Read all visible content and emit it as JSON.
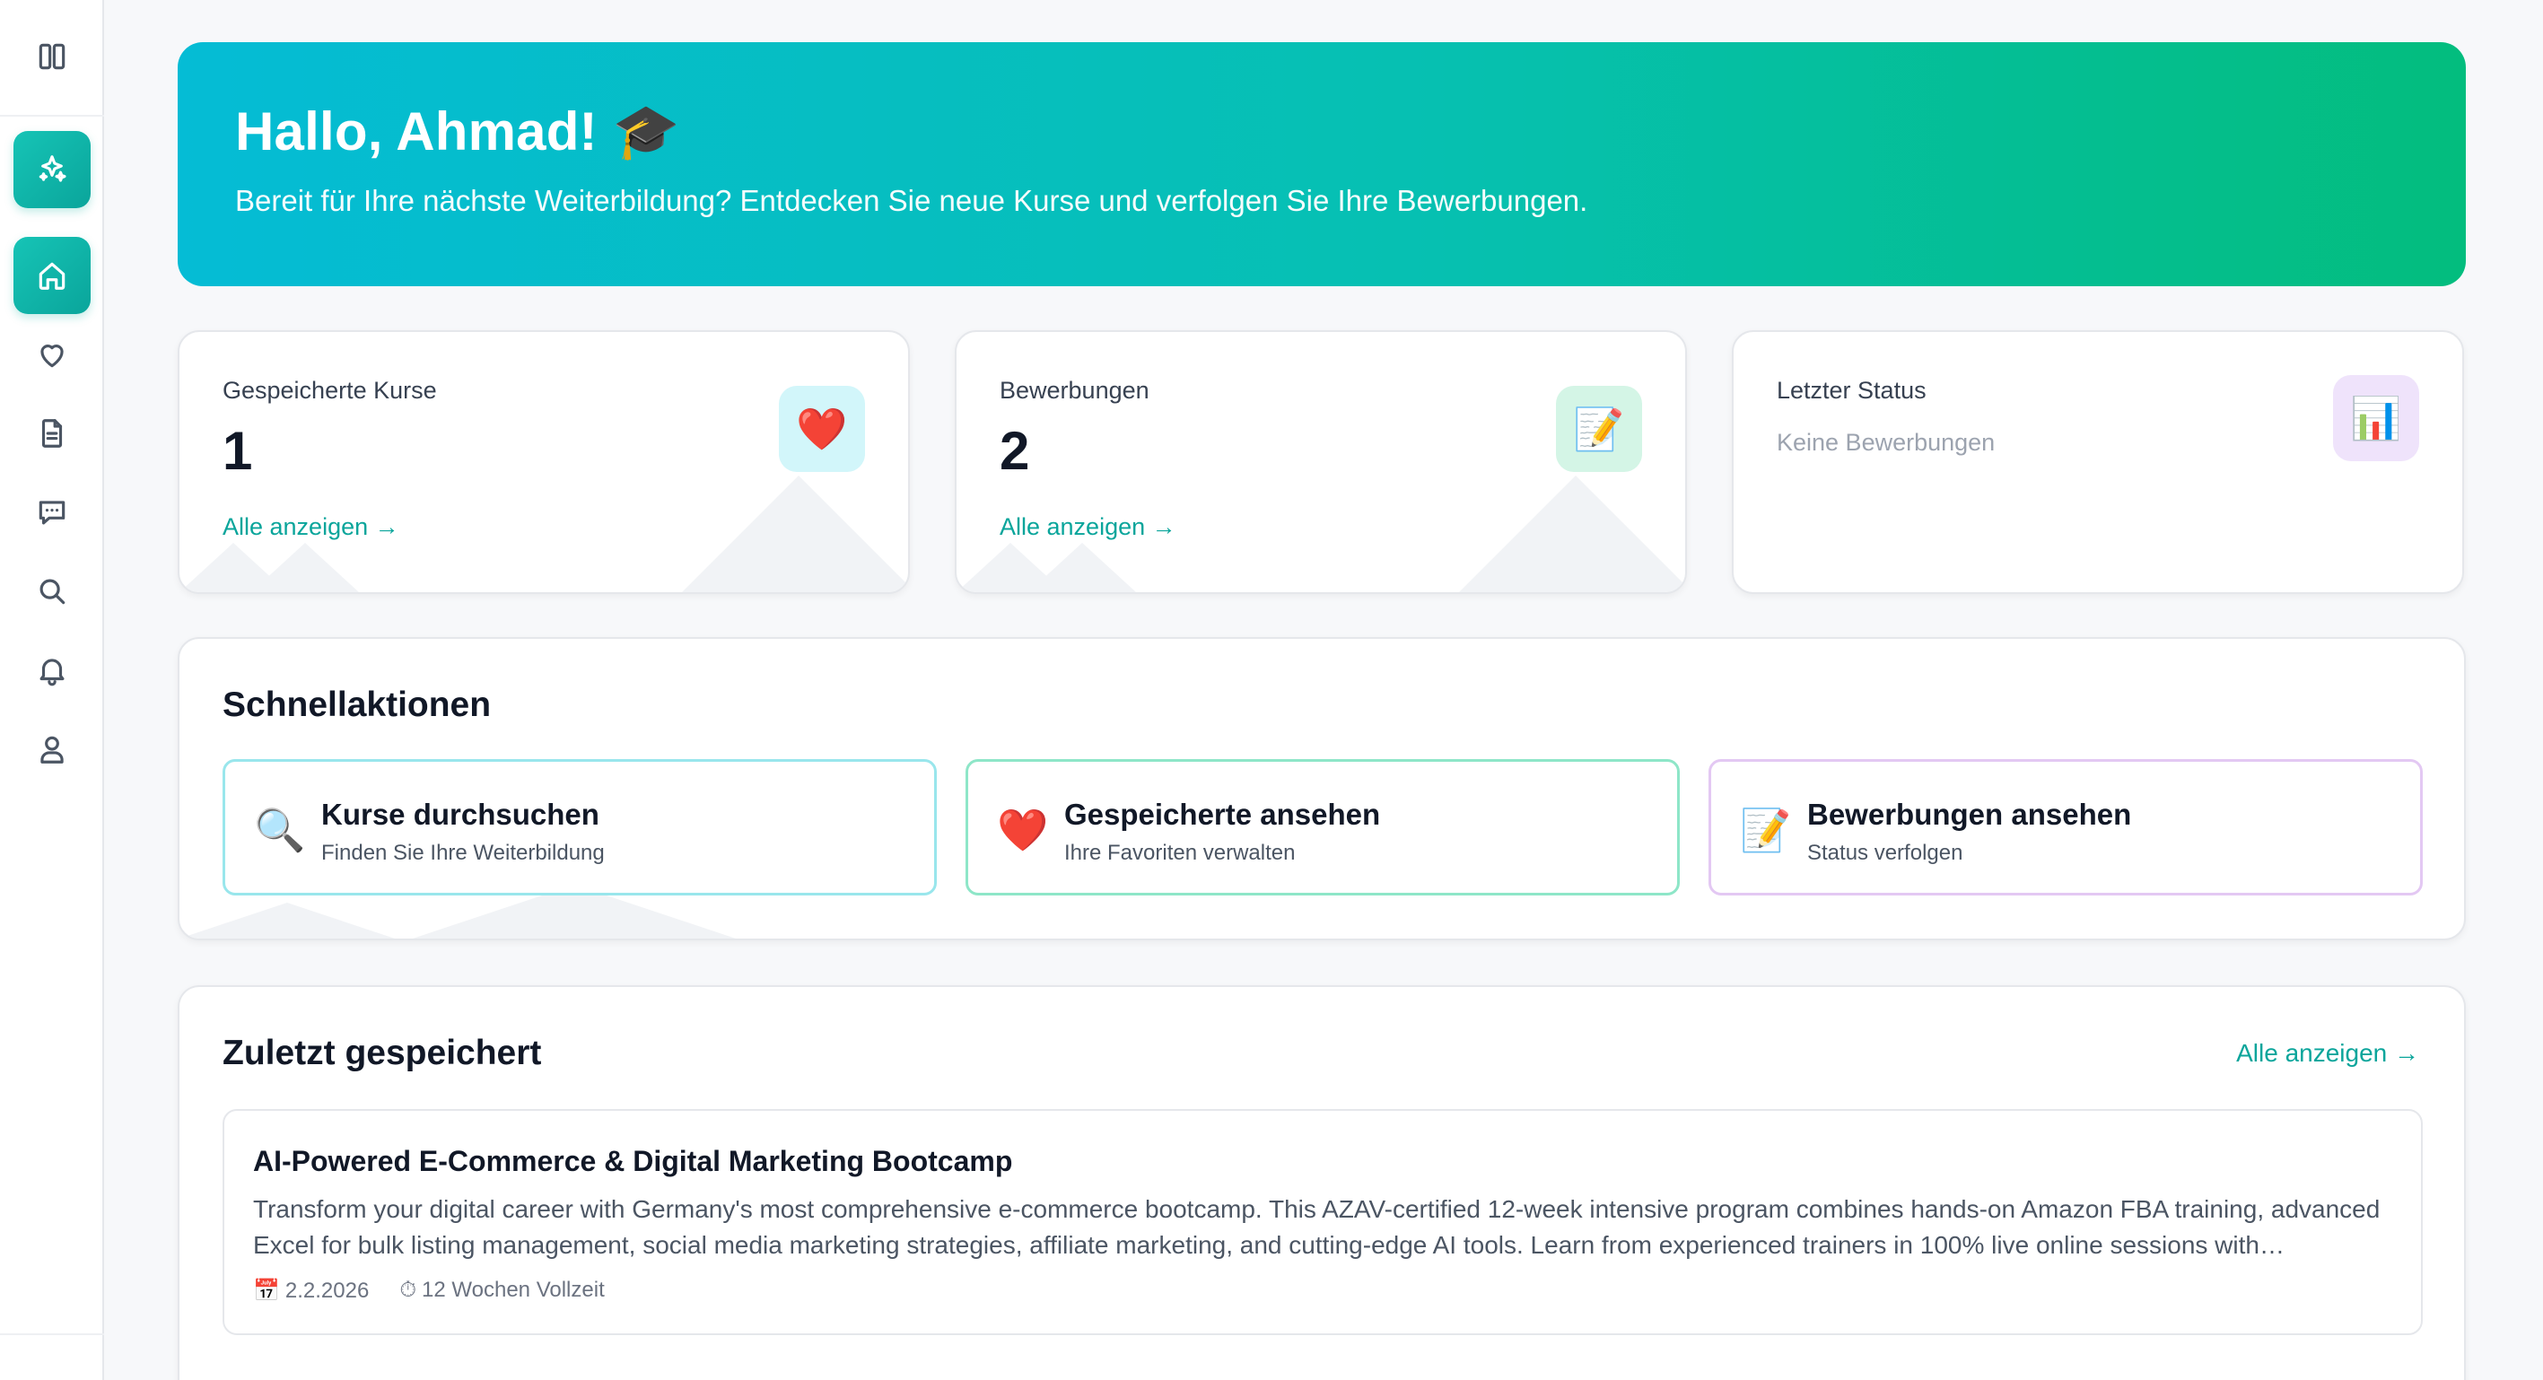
{
  "sidebar": {
    "items": [
      {
        "name": "panel-toggle-icon"
      },
      {
        "name": "ai-sparkle-icon"
      },
      {
        "name": "home-icon"
      },
      {
        "name": "heart-icon"
      },
      {
        "name": "document-icon"
      },
      {
        "name": "chat-icon"
      },
      {
        "name": "search-icon"
      },
      {
        "name": "bell-icon"
      },
      {
        "name": "user-icon"
      }
    ]
  },
  "hero": {
    "title": "Hallo, Ahmad! 🎓",
    "subtitle": "Bereit für Ihre nächste Weiterbildung? Entdecken Sie neue Kurse und verfolgen Sie Ihre Bewerbungen."
  },
  "stats": {
    "saved": {
      "label": "Gespeicherte Kurse",
      "value": "1",
      "link": "Alle anzeigen →",
      "icon": "❤️"
    },
    "applications": {
      "label": "Bewerbungen",
      "value": "2",
      "link": "Alle anzeigen →",
      "icon": "📝"
    },
    "status": {
      "label": "Letzter Status",
      "value": "Keine Bewerbungen",
      "icon": "📊"
    }
  },
  "quick_actions": {
    "title": "Schnellaktionen",
    "items": [
      {
        "icon": "🔍",
        "title": "Kurse durchsuchen",
        "subtitle": "Finden Sie Ihre Weiterbildung",
        "border": "#99e6ec"
      },
      {
        "icon": "❤️",
        "title": "Gespeicherte ansehen",
        "subtitle": "Ihre Favoriten verwalten",
        "border": "#8ee6c8"
      },
      {
        "icon": "📝",
        "title": "Bewerbungen ansehen",
        "subtitle": "Status verfolgen",
        "border": "#e3c8f3"
      }
    ]
  },
  "recent": {
    "title": "Zuletzt gespeichert",
    "link": "Alle anzeigen →",
    "course": {
      "title": "AI-Powered E-Commerce & Digital Marketing Bootcamp",
      "description": "Transform your digital career with Germany's most comprehensive e-commerce bootcamp. This AZAV-certified 12-week intensive program combines hands-on Amazon FBA training, advanced Excel for bulk listing management, social media marketing strategies, affiliate marketing, and cutting-edge AI tools. Learn from experienced trainers in 100% live online sessions with…",
      "date_icon": "📅",
      "date": "2.2.2026",
      "duration_icon": "⏱",
      "duration": "12 Wochen Vollzeit"
    }
  },
  "colors": {
    "accent": "#0aa59b",
    "hero_start": "#05bcd5",
    "hero_end": "#03bd7e"
  }
}
